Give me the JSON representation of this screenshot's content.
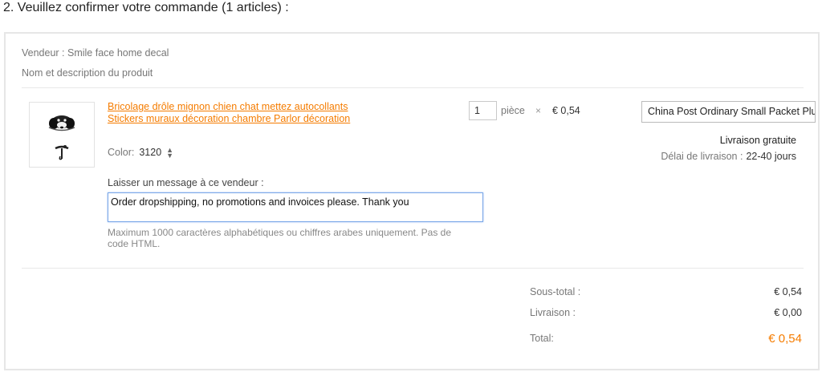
{
  "header": {
    "title": "2. Veuillez confirmer votre commande (1 articles) :"
  },
  "order": {
    "seller": "Vendeur : Smile face home decal",
    "product_header": "Nom et description du produit",
    "product": {
      "title": "Bricolage drôle mignon chien chat mettez autocollants Stickers muraux décoration chambre Parlor décoration",
      "color_label": "Color:",
      "color_value": "3120",
      "thumbnail_icon": "dog-sticker-image"
    },
    "message": {
      "label": "Laisser un message à ce vendeur :",
      "value": "Order dropshipping, no promotions and invoices please. Thank you",
      "help": "Maximum 1000 caractères alphabétiques ou chiffres arabes uniquement. Pas de code HTML."
    },
    "quantity": {
      "value": "1",
      "unit": "pièce",
      "times": "×",
      "unit_price": "€ 0,54"
    },
    "shipping": {
      "method": "China Post Ordinary Small Packet Plus",
      "cost": "Livraison gratuite",
      "delivery_label": "Délai de livraison :",
      "delivery_days": "22-40 jours"
    },
    "summary": {
      "subtotal_label": "Sous-total :",
      "subtotal_value": "€ 0,54",
      "shipping_label": "Livraison :",
      "shipping_value": "€ 0,00",
      "total_label": "Total:",
      "total_value": "€ 0,54"
    }
  },
  "colors": {
    "accent": "#f57c00",
    "border": "#e6e6e6",
    "focus": "#7aa7e8"
  }
}
